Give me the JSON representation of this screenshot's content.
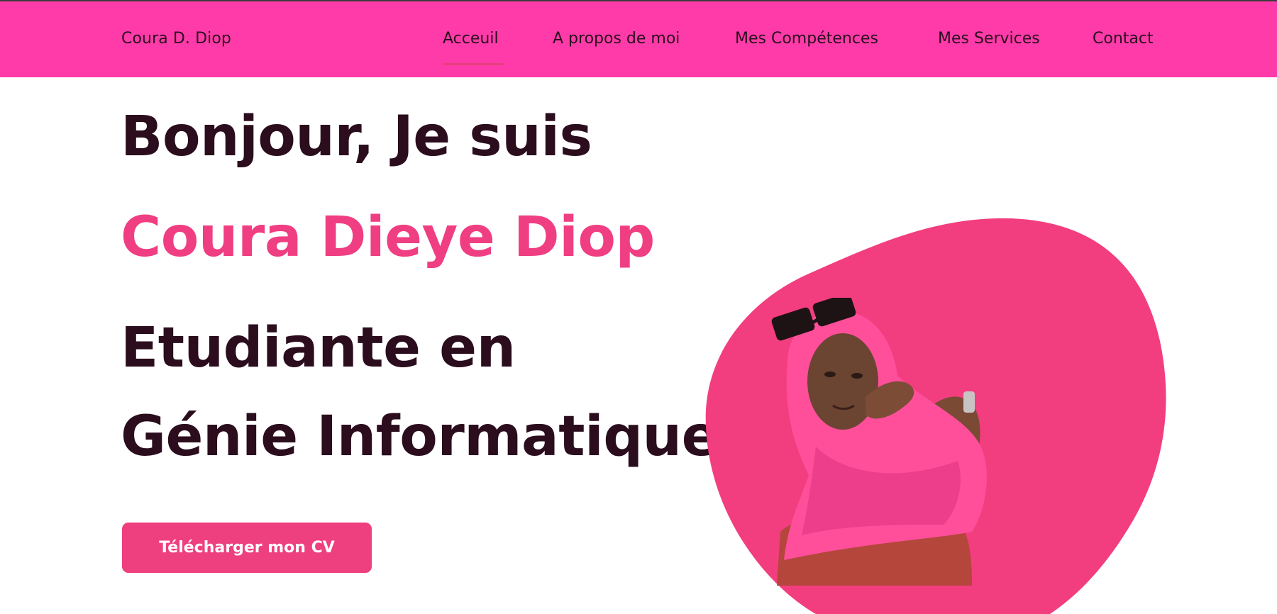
{
  "brand": {
    "name": "Coura D. Diop"
  },
  "nav": {
    "items": [
      {
        "label": "Acceuil"
      },
      {
        "label": "A propos de moi"
      },
      {
        "label": "Mes Compétences"
      },
      {
        "label": "Mes Services"
      },
      {
        "label": "Contact"
      }
    ],
    "active": "Acceuil"
  },
  "hero": {
    "greeting": "Bonjour, Je suis",
    "name": "Coura Dieye Diop",
    "title_line1": "Etudiante en",
    "title_line2": "Génie Informatique",
    "cv_button": "Télécharger mon CV"
  },
  "colors": {
    "navbar": "#ff3ba9",
    "accent": "#f03e82",
    "text_dark": "#2b0d1d",
    "blob": "#f23e7f"
  },
  "icons": {
    "profile_photo": "profile-photo"
  }
}
